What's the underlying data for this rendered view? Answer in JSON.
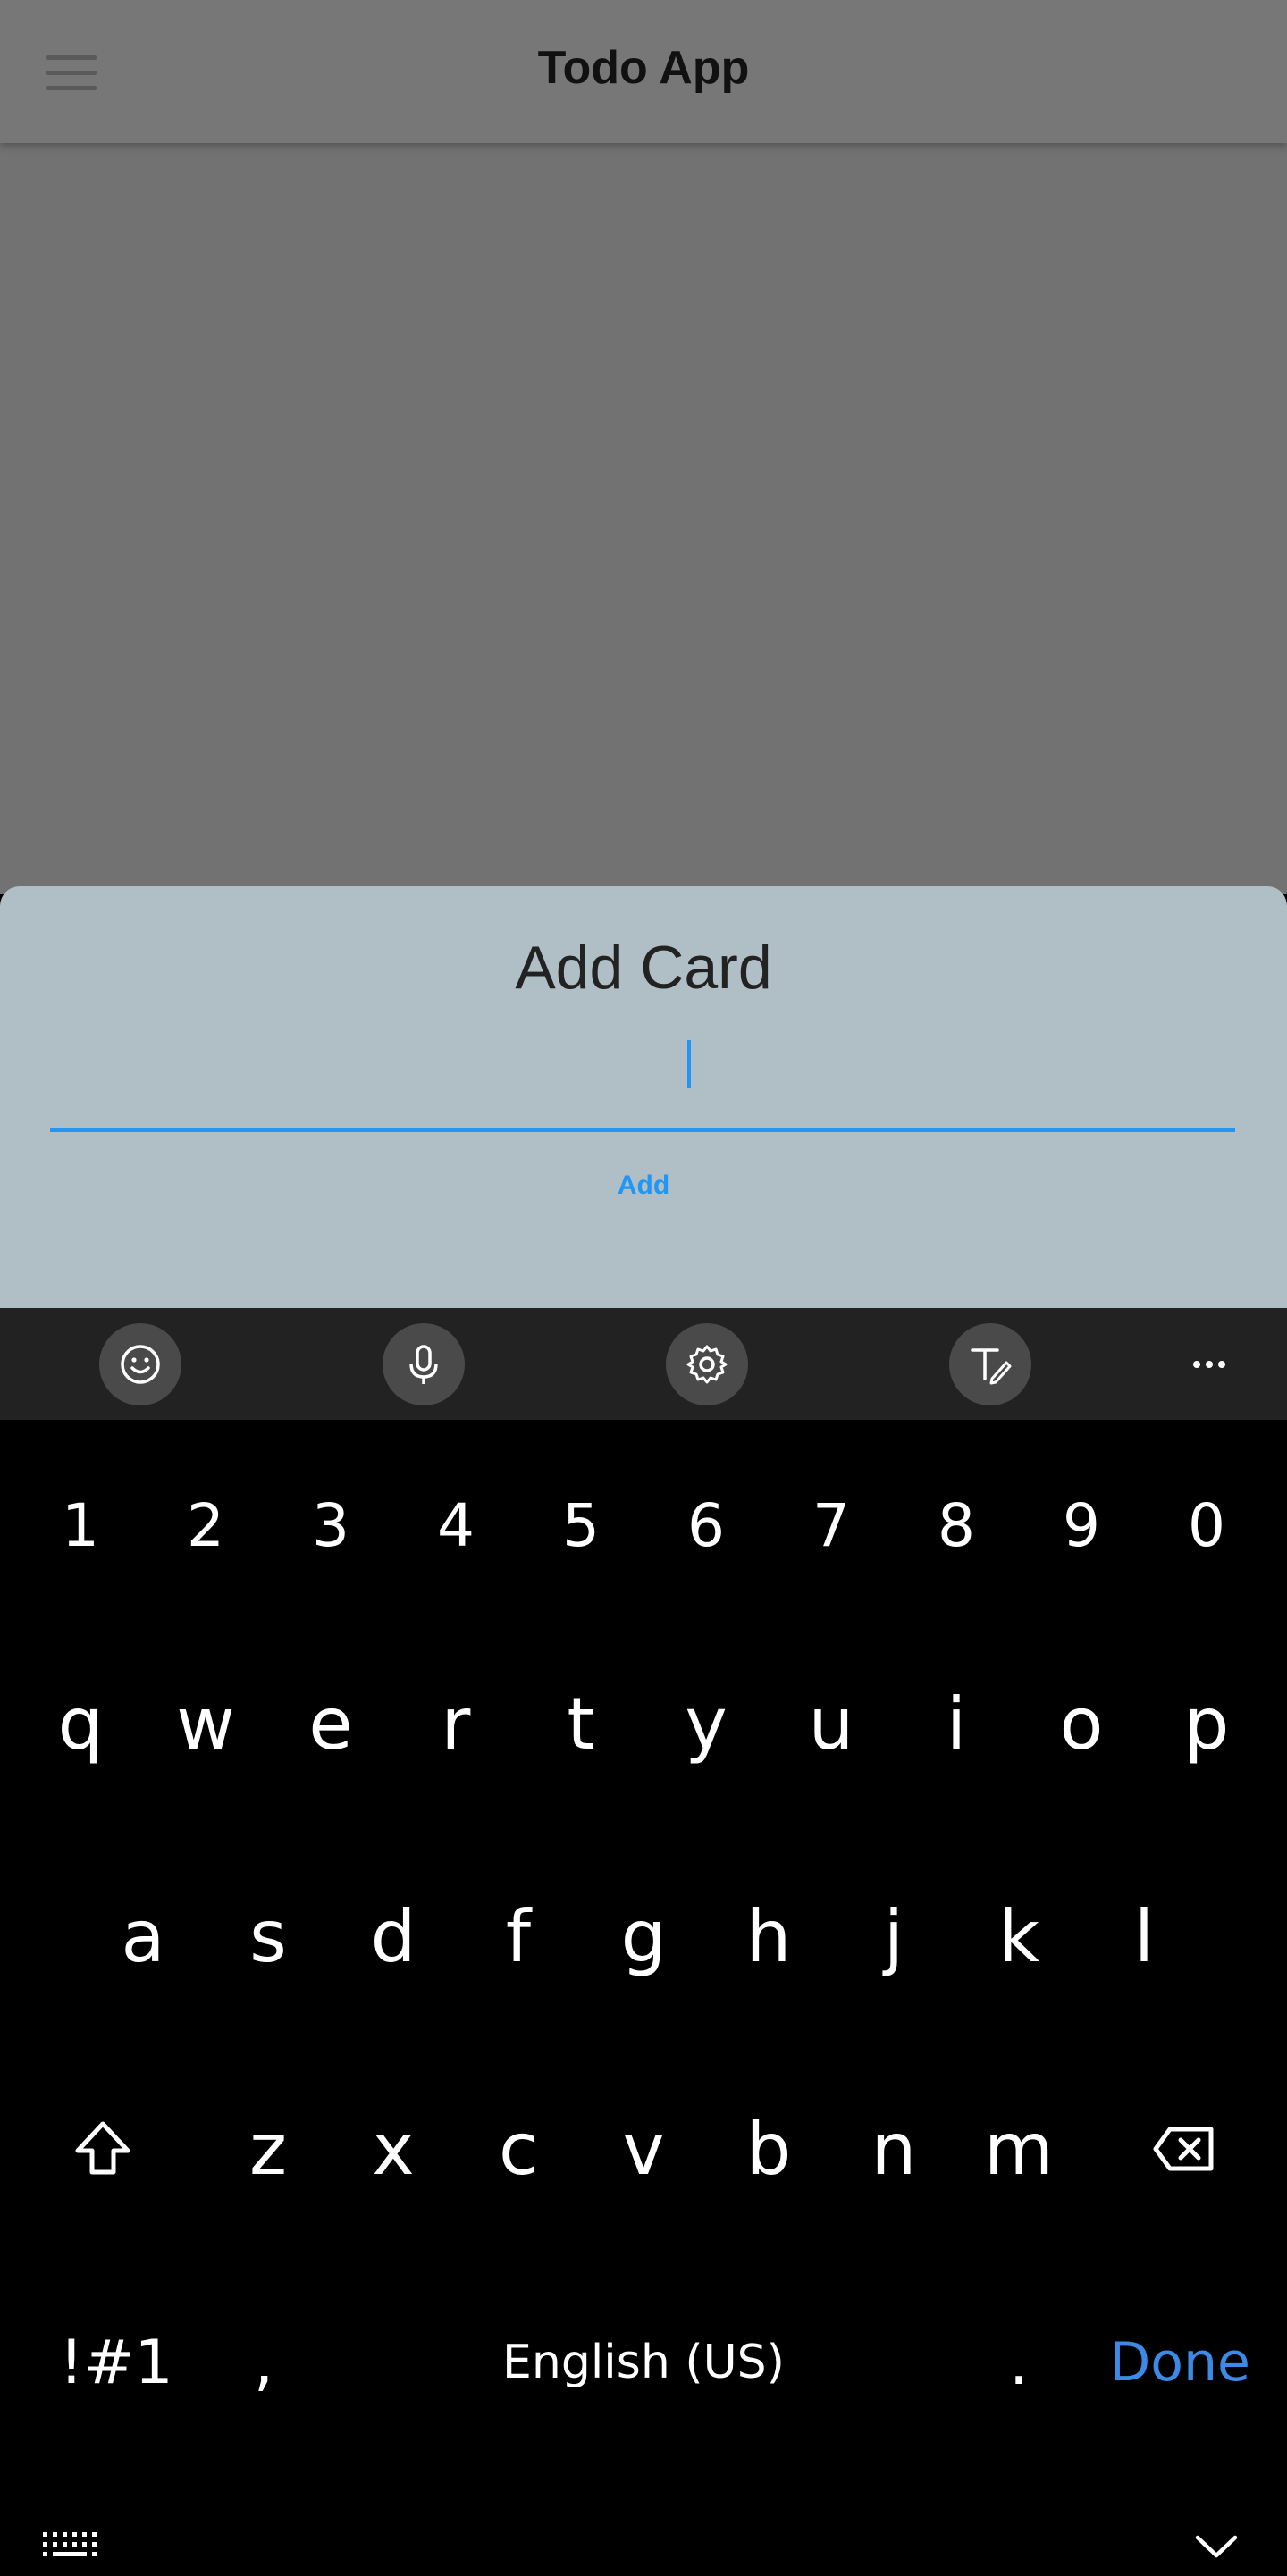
{
  "app_bar": {
    "title": "Todo App",
    "menu_icon": "hamburger-menu-icon"
  },
  "sheet": {
    "title": "Add Card",
    "input_value": "",
    "add_label": "Add"
  },
  "keyboard_toolbar": {
    "icons": [
      "emoji-icon",
      "microphone-icon",
      "settings-icon",
      "handwriting-icon",
      "more-icon"
    ]
  },
  "keyboard": {
    "number_row": [
      "1",
      "2",
      "3",
      "4",
      "5",
      "6",
      "7",
      "8",
      "9",
      "0"
    ],
    "row1": [
      "q",
      "w",
      "e",
      "r",
      "t",
      "y",
      "u",
      "i",
      "o",
      "p"
    ],
    "row2": [
      "a",
      "s",
      "d",
      "f",
      "g",
      "h",
      "j",
      "k",
      "l"
    ],
    "row3": [
      "z",
      "x",
      "c",
      "v",
      "b",
      "n",
      "m"
    ],
    "symbols_label": "!#1",
    "comma_label": ",",
    "space_label": "English (US)",
    "period_label": ".",
    "done_label": "Done"
  },
  "colors": {
    "accent": "#2196f3",
    "sheet_bg": "#b0bec5",
    "scrim": "#727272",
    "done": "#3d8ae6"
  }
}
